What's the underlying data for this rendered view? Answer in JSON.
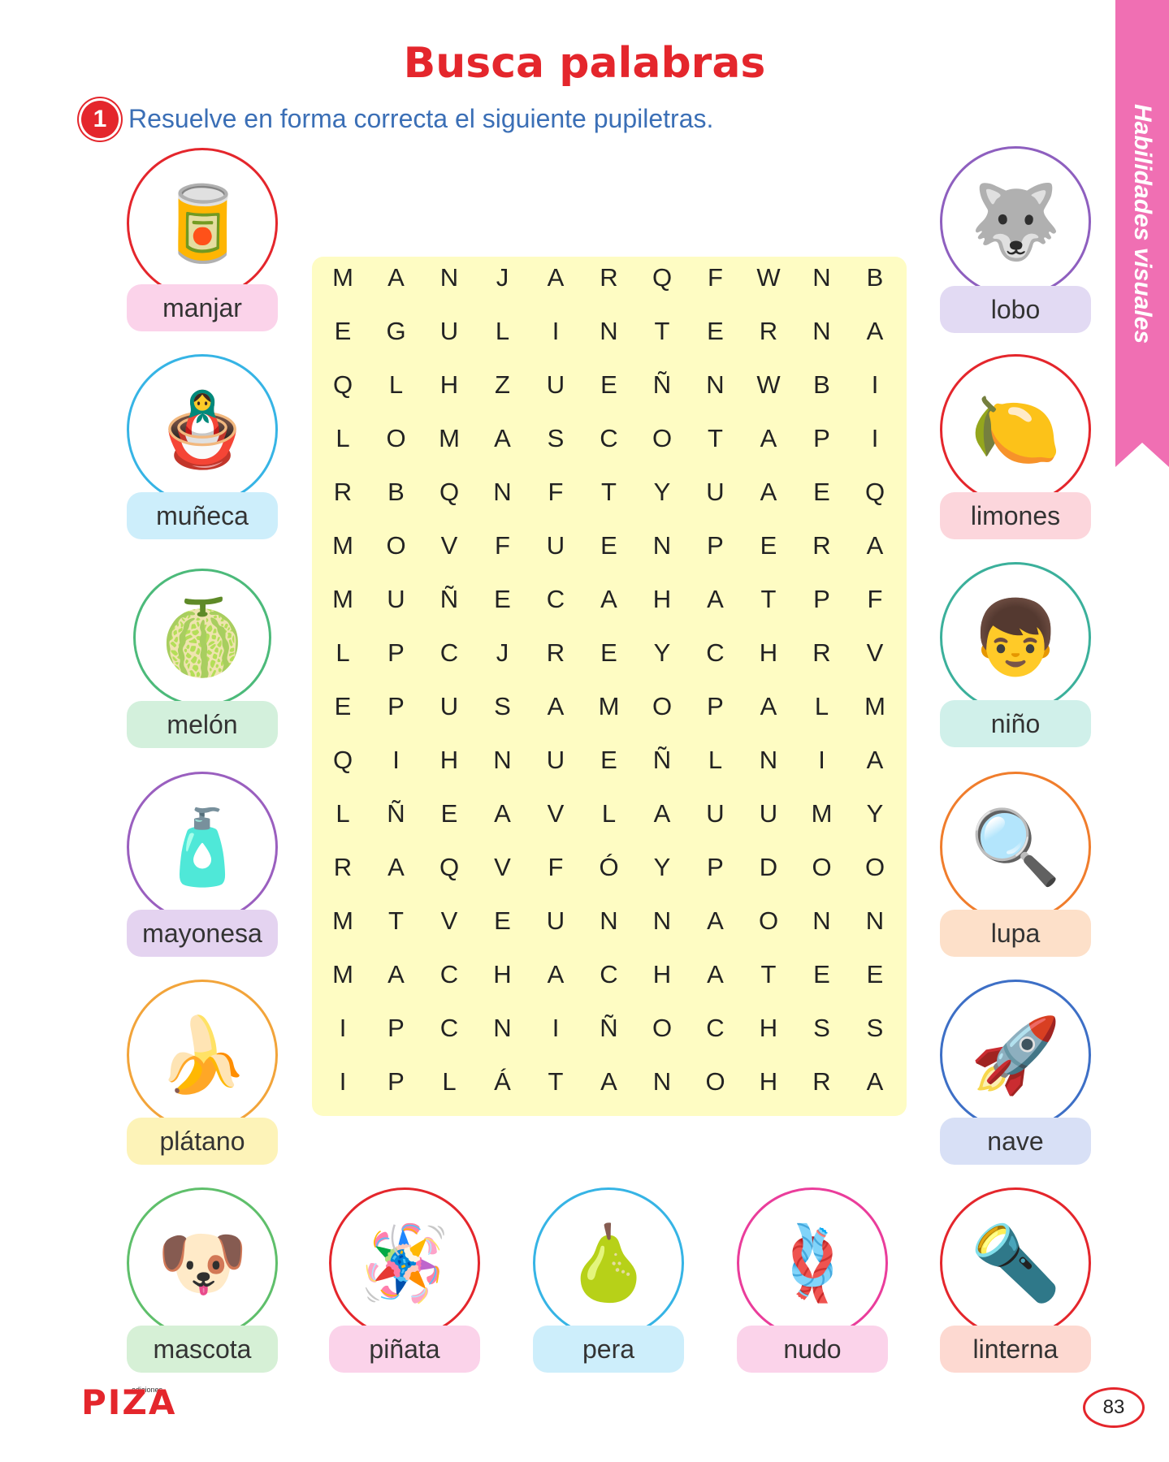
{
  "page": {
    "title": "Busca palabras",
    "exercise_number": "1",
    "instruction": "Resuelve en forma correcta el siguiente pupiletras.",
    "side_tab": "Habilidades visuales",
    "logo_small": "ediciones",
    "logo": "PIZA",
    "page_number": "83"
  },
  "grid": [
    [
      "M",
      "A",
      "N",
      "J",
      "A",
      "R",
      "Q",
      "F",
      "W",
      "N",
      "B"
    ],
    [
      "E",
      "G",
      "U",
      "L",
      "I",
      "N",
      "T",
      "E",
      "R",
      "N",
      "A"
    ],
    [
      "Q",
      "L",
      "H",
      "Z",
      "U",
      "E",
      "Ñ",
      "N",
      "W",
      "B",
      "I"
    ],
    [
      "L",
      "O",
      "M",
      "A",
      "S",
      "C",
      "O",
      "T",
      "A",
      "P",
      "I"
    ],
    [
      "R",
      "B",
      "Q",
      "N",
      "F",
      "T",
      "Y",
      "U",
      "A",
      "E",
      "Q"
    ],
    [
      "M",
      "O",
      "V",
      "F",
      "U",
      "E",
      "N",
      "P",
      "E",
      "R",
      "A"
    ],
    [
      "M",
      "U",
      "Ñ",
      "E",
      "C",
      "A",
      "H",
      "A",
      "T",
      "P",
      "F"
    ],
    [
      "L",
      "P",
      "C",
      "J",
      "R",
      "E",
      "Y",
      "C",
      "H",
      "R",
      "V"
    ],
    [
      "E",
      "P",
      "U",
      "S",
      "A",
      "M",
      "O",
      "P",
      "A",
      "L",
      "M"
    ],
    [
      "Q",
      "I",
      "H",
      "N",
      "U",
      "E",
      "Ñ",
      "L",
      "N",
      "I",
      "A"
    ],
    [
      "L",
      "Ñ",
      "E",
      "A",
      "V",
      "L",
      "A",
      "U",
      "U",
      "M",
      "Y"
    ],
    [
      "R",
      "A",
      "Q",
      "V",
      "F",
      "Ó",
      "Y",
      "P",
      "D",
      "O",
      "O"
    ],
    [
      "M",
      "T",
      "V",
      "E",
      "U",
      "N",
      "N",
      "A",
      "O",
      "N",
      "N"
    ],
    [
      "M",
      "A",
      "C",
      "H",
      "A",
      "C",
      "H",
      "A",
      "T",
      "E",
      "E"
    ],
    [
      "I",
      "P",
      "C",
      "N",
      "I",
      "Ñ",
      "O",
      "C",
      "H",
      "S",
      "S"
    ],
    [
      "I",
      "P",
      "L",
      "Á",
      "T",
      "A",
      "N",
      "O",
      "H",
      "R",
      "A"
    ]
  ],
  "items": {
    "manjar": {
      "label": "manjar",
      "ring": "#e4262c",
      "pill": "#fbd3ea",
      "icon": "🥫"
    },
    "muneca": {
      "label": "muñeca",
      "ring": "#36b4e5",
      "pill": "#cdeefb",
      "icon": "🪆"
    },
    "melon": {
      "label": "melón",
      "ring": "#4cba7a",
      "pill": "#d3f0dc",
      "icon": "🍈"
    },
    "mayonesa": {
      "label": "mayonesa",
      "ring": "#9a5fbf",
      "pill": "#e4d3f0",
      "icon": "🧴"
    },
    "platano": {
      "label": "plátano",
      "ring": "#f2a43a",
      "pill": "#fdf3b8",
      "icon": "🍌"
    },
    "mascota": {
      "label": "mascota",
      "ring": "#5fbf6b",
      "pill": "#d6f0d6",
      "icon": "🐶"
    },
    "pinata": {
      "label": "piñata",
      "ring": "#e4262c",
      "pill": "#fbd3ea",
      "icon": "🪅"
    },
    "pera": {
      "label": "pera",
      "ring": "#36b4e5",
      "pill": "#cdeefb",
      "icon": "🍐"
    },
    "nudo": {
      "label": "nudo",
      "ring": "#ea3d9b",
      "pill": "#fbd3ea",
      "icon": "🪢"
    },
    "linterna": {
      "label": "linterna",
      "ring": "#e4262c",
      "pill": "#fdd9d1",
      "icon": "🔦"
    },
    "lobo": {
      "label": "lobo",
      "ring": "#8e5fbf",
      "pill": "#e2daf3",
      "icon": "🐺"
    },
    "limones": {
      "label": "limones",
      "ring": "#e4262c",
      "pill": "#fcd6dc",
      "icon": "🍋"
    },
    "nino": {
      "label": "niño",
      "ring": "#3bb09b",
      "pill": "#d0f0ea",
      "icon": "👦"
    },
    "lupa": {
      "label": "lupa",
      "ring": "#f07d2c",
      "pill": "#fde0c9",
      "icon": "🔍"
    },
    "nave": {
      "label": "nave",
      "ring": "#3d6fc6",
      "pill": "#d8e0f6",
      "icon": "🚀"
    }
  }
}
